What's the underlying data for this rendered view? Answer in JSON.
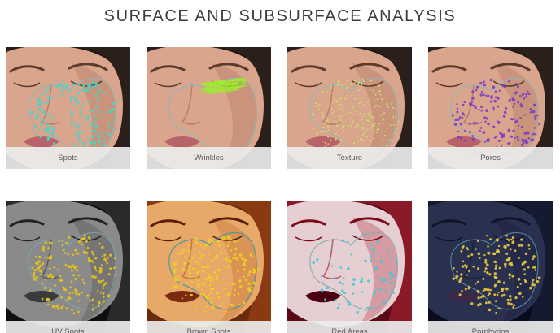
{
  "page_title": "SURFACE AND SUBSURFACE ANALYSIS",
  "tiles": [
    {
      "label": "Spots",
      "variant": "natural",
      "overlay": "spots",
      "dot_color": "#40d8cc"
    },
    {
      "label": "Wrinkles",
      "variant": "natural",
      "overlay": "wrinkles",
      "dot_color": "#9cf02a"
    },
    {
      "label": "Texture",
      "variant": "natural",
      "overlay": "texture",
      "dot_color": "#c8ef60"
    },
    {
      "label": "Pores",
      "variant": "natural",
      "overlay": "pores",
      "dot_color": "#7a3cc8"
    },
    {
      "label": "UV Spots",
      "variant": "grayscale",
      "overlay": "uvspots",
      "dot_color": "#e8c21a"
    },
    {
      "label": "Brown Spots",
      "variant": "brown",
      "overlay": "brownspots",
      "dot_color": "#f0d020"
    },
    {
      "label": "Red Areas",
      "variant": "red",
      "overlay": "redareas",
      "dot_color": "#40c8d8"
    },
    {
      "label": "Porphyrins",
      "variant": "dark-blue",
      "overlay": "porphyrins",
      "dot_color": "#e8c840"
    }
  ]
}
